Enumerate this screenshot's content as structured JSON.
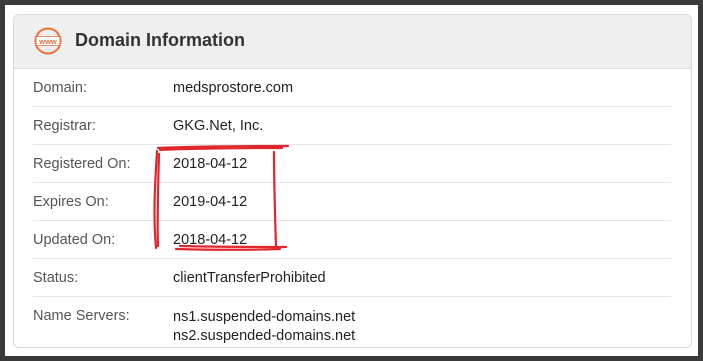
{
  "header": {
    "icon": "www-globe-icon",
    "icon_text": "www",
    "title": "Domain Information"
  },
  "rows": [
    {
      "label": "Domain:",
      "value": "medsprostore.com"
    },
    {
      "label": "Registrar:",
      "value": "GKG.Net, Inc."
    },
    {
      "label": "Registered On:",
      "value": "2018-04-12"
    },
    {
      "label": "Expires On:",
      "value": "2019-04-12"
    },
    {
      "label": "Updated On:",
      "value": "2018-04-12"
    },
    {
      "label": "Status:",
      "value": "clientTransferProhibited"
    }
  ],
  "name_servers": {
    "label": "Name Servers:",
    "values": [
      "ns1.suspended-domains.net",
      "ns2.suspended-domains.net"
    ]
  },
  "colors": {
    "accent_icon": "#e8703a",
    "annotation": "#e0262b",
    "header_bg": "#efefef",
    "backdrop": "#3a3a3a"
  }
}
